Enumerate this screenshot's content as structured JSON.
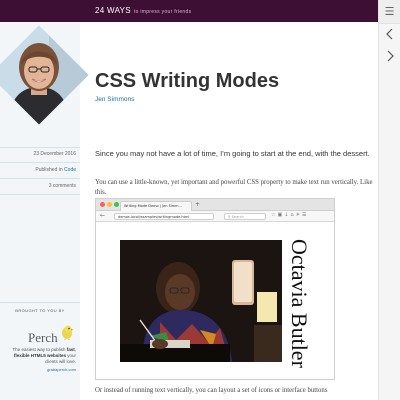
{
  "site": {
    "brand": "24 WAYS",
    "tagline": "to impress your friends"
  },
  "article": {
    "title": "CSS Writing Modes",
    "author": "Jen Simmons",
    "date": "23 December 2016",
    "published_prefix": "Published in ",
    "category": "Code",
    "comments": "3 comments",
    "lead": "Since you may not have a lot of time, I’m going to start at the end, with the dessert.",
    "paragraph1": "You can use a little-known, yet important and powerful CSS property to make text run vertically. Like this.",
    "paragraph2": "Or instead of running text vertically, you can layout a set of icons or interface buttons"
  },
  "sponsor": {
    "brought_label": "BROUGHT TO YOU BY",
    "logo_text": "Perch",
    "description_parts": [
      "The easiest way to publish ",
      "fast",
      ", ",
      "flexible HTML5 websites",
      " your clients will love."
    ],
    "url": "grabaperch.com"
  },
  "screenshot": {
    "tab_title": "Writing Mode Demo | Jen Simm...",
    "url": "demos.local/examples/writingmode.html",
    "search_placeholder": "Search",
    "vertical_text": "Octavia Butler"
  },
  "nav": {
    "menu_icon": "hamburger-icon",
    "prev_icon": "chevron-left-icon",
    "next_icon": "chevron-right-icon"
  },
  "colors": {
    "topbar": "#3d0f35",
    "link": "#1f6da3",
    "sidebar": "#f2f6f9"
  }
}
